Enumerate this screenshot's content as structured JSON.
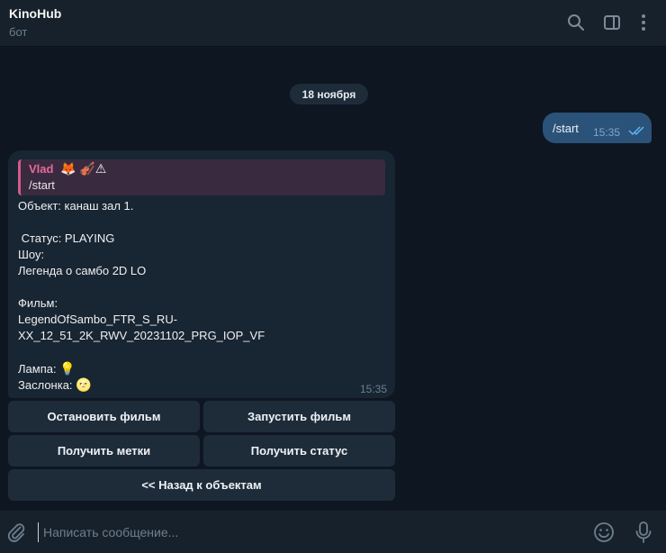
{
  "header": {
    "title": "KinoHub",
    "subtitle": "бот",
    "icons": [
      "search-icon",
      "sidebar-toggle-icon",
      "more-vertical-icon"
    ]
  },
  "chat": {
    "date": "18 ноября",
    "outgoing": {
      "text": "/start",
      "time": "15:35",
      "status": "read"
    },
    "incoming": {
      "reply": {
        "name": "Vlad",
        "emoji": "🦊 🎻⚠",
        "text": "/start"
      },
      "lines": [
        "Объект: канаш зал 1.",
        " Статус: PLAYING",
        "Шоу:",
        "Легенда о самбо 2D LO",
        "Фильм:",
        "LegendOfSambo_FTR_S_RU-",
        "XX_12_51_2K_RWV_20231102_PRG_IOP_VF"
      ],
      "lamp_label": "Лампа:",
      "lamp_emoji": "💡",
      "shutter_label": "Заслонка:",
      "shutter_emoji": "🌝",
      "time": "15:35"
    },
    "keyboard": {
      "stop_film": "Остановить фильм",
      "start_film": "Запустить фильм",
      "get_marks": "Получить метки",
      "get_status": "Получить статус",
      "back": "<< Назад к объектам"
    }
  },
  "input": {
    "placeholder": "Написать сообщение...",
    "value": ""
  },
  "colors": {
    "background": "#0e1621",
    "header": "#17212b",
    "outgoing_bubble": "#2b5278",
    "incoming_bubble": "#182533",
    "reply_accent": "#e36b9a",
    "button": "#1e2c3a"
  }
}
